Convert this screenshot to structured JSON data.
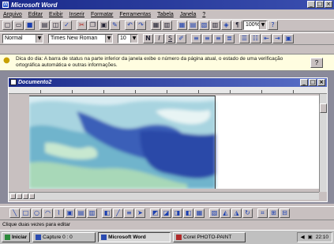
{
  "window": {
    "title": "Microsoft Word",
    "buttons": [
      "_",
      "□",
      "×"
    ]
  },
  "menu": {
    "items": [
      "Arquivo",
      "Editar",
      "Exibir",
      "Inserir",
      "Formatar",
      "Ferramentas",
      "Tabela",
      "Janela",
      "?"
    ]
  },
  "standard_toolbar": {
    "zoom": "100%"
  },
  "format_toolbar": {
    "style": "Normal",
    "font": "Times New Roman",
    "size": "10",
    "bold": "N",
    "italic": "I",
    "underline": "S"
  },
  "tip": {
    "text": "Dica do dia: A barra de status na parte inferior da janela exibe o número da página atual, o estado de uma verificação ortográfica automática e outras informações.",
    "button": "?"
  },
  "document": {
    "title": "Documento2"
  },
  "status": {
    "text": "Clique duas vezes para editar"
  },
  "taskbar": {
    "start": "Iniciar",
    "tasks": [
      "Capture 0 : 0",
      "Microsoft Word",
      "Corel PHOTO-PAINT"
    ],
    "active_task": "Microsoft Word",
    "clock": "22:10"
  }
}
